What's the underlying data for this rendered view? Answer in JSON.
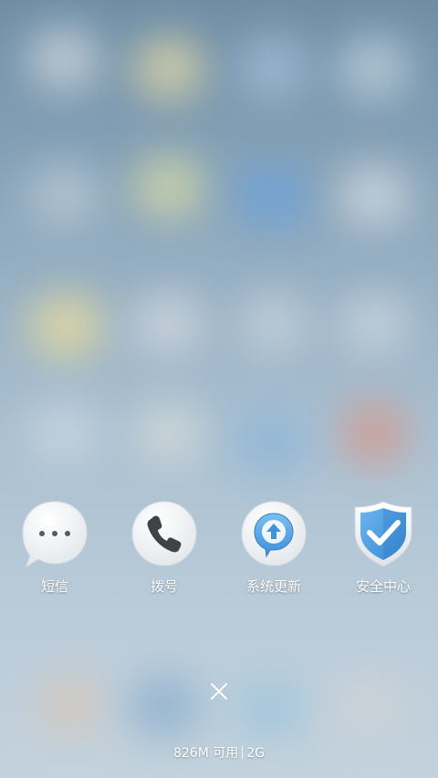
{
  "recent_apps": [
    {
      "label": "短信",
      "icon": "message-bubble-icon"
    },
    {
      "label": "拨号",
      "icon": "phone-icon"
    },
    {
      "label": "系统更新",
      "icon": "system-update-icon"
    },
    {
      "label": "安全中心",
      "icon": "security-shield-icon"
    }
  ],
  "close": {
    "icon": "close-icon"
  },
  "status": {
    "memory": "826M 可用",
    "network": "2G"
  },
  "colors": {
    "update_blue": "#3f93d8",
    "shield_blue": "#4a9de0",
    "label_text": "#ffffff"
  }
}
